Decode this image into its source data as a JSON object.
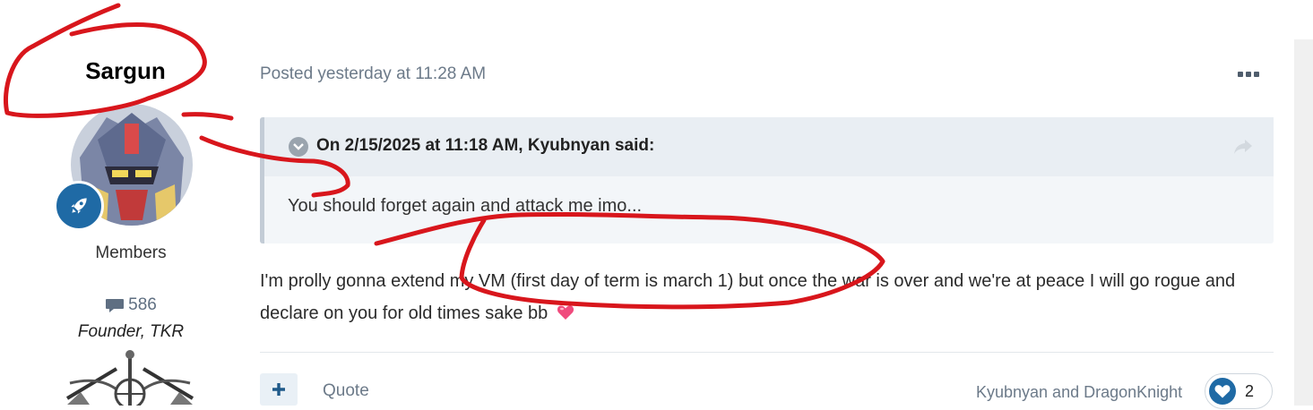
{
  "author": {
    "name": "Sargun",
    "group": "Members",
    "post_count": "586",
    "member_title": "Founder, TKR"
  },
  "post": {
    "timestamp": "Posted yesterday at 11:28 AM",
    "quote": {
      "citation": "On 2/15/2025 at 11:18 AM, Kyubnyan said:",
      "text": "You should forget again and attack me imo..."
    },
    "body": "I'm prolly gonna extend my VM (first day of term is march 1) but once the war is over and we're at peace I will go rogue and declare on you for old times sake bb"
  },
  "footer": {
    "plus_label": "+",
    "quote_label": "Quote",
    "reacted_by": "Kyubnyan and DragonKnight",
    "reaction_count": "2"
  },
  "icons": {
    "more": "more-dots-icon",
    "rank": "rocket-icon",
    "comments": "comment-bubble-icon",
    "toggle": "chevron-down-icon",
    "share": "share-arrow-icon",
    "reaction": "heart-icon",
    "emoji": "pink-heart-emoji"
  },
  "colors": {
    "accent": "#1f6aa5",
    "annotation": "#d8161c",
    "muted": "#6c7a89"
  }
}
